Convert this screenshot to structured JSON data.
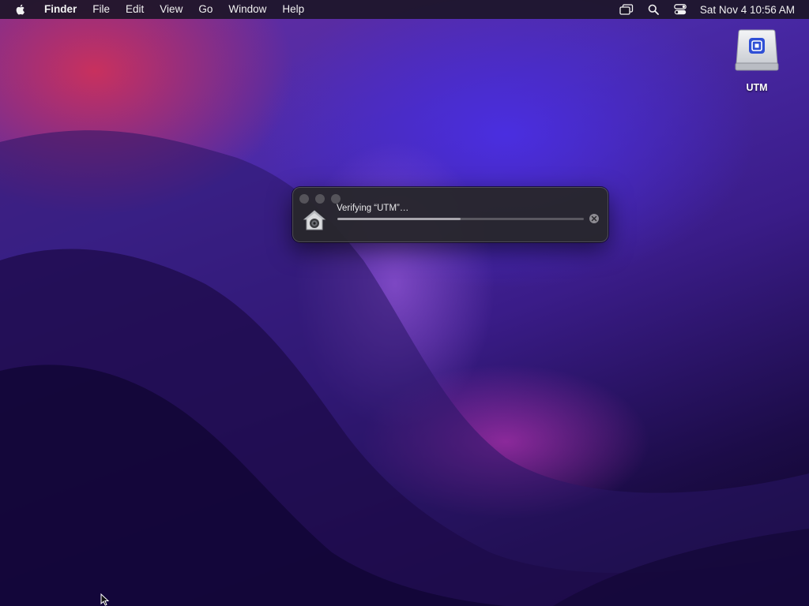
{
  "menubar": {
    "apple_icon": "apple-logo-icon",
    "app_name": "Finder",
    "items": [
      "File",
      "Edit",
      "View",
      "Go",
      "Window",
      "Help"
    ],
    "status_icons": [
      "screen-mirroring-icon",
      "spotlight-search-icon",
      "control-center-icon"
    ],
    "clock": "Sat Nov 4  10:56 AM"
  },
  "desktop": {
    "icons": [
      {
        "label": "UTM",
        "icon": "disk-image-drive-icon"
      }
    ]
  },
  "progress_window": {
    "title": "Verifying “UTM”…",
    "progress": 0.5,
    "app_icon": "finder-home-icon",
    "stop_icon": "stop-cancel-icon"
  },
  "colors": {
    "menubar_bg": "#1c1628",
    "panel_bg": "#28262c",
    "progress_fill": "#a8a6ad",
    "progress_track": "#5a5860"
  }
}
